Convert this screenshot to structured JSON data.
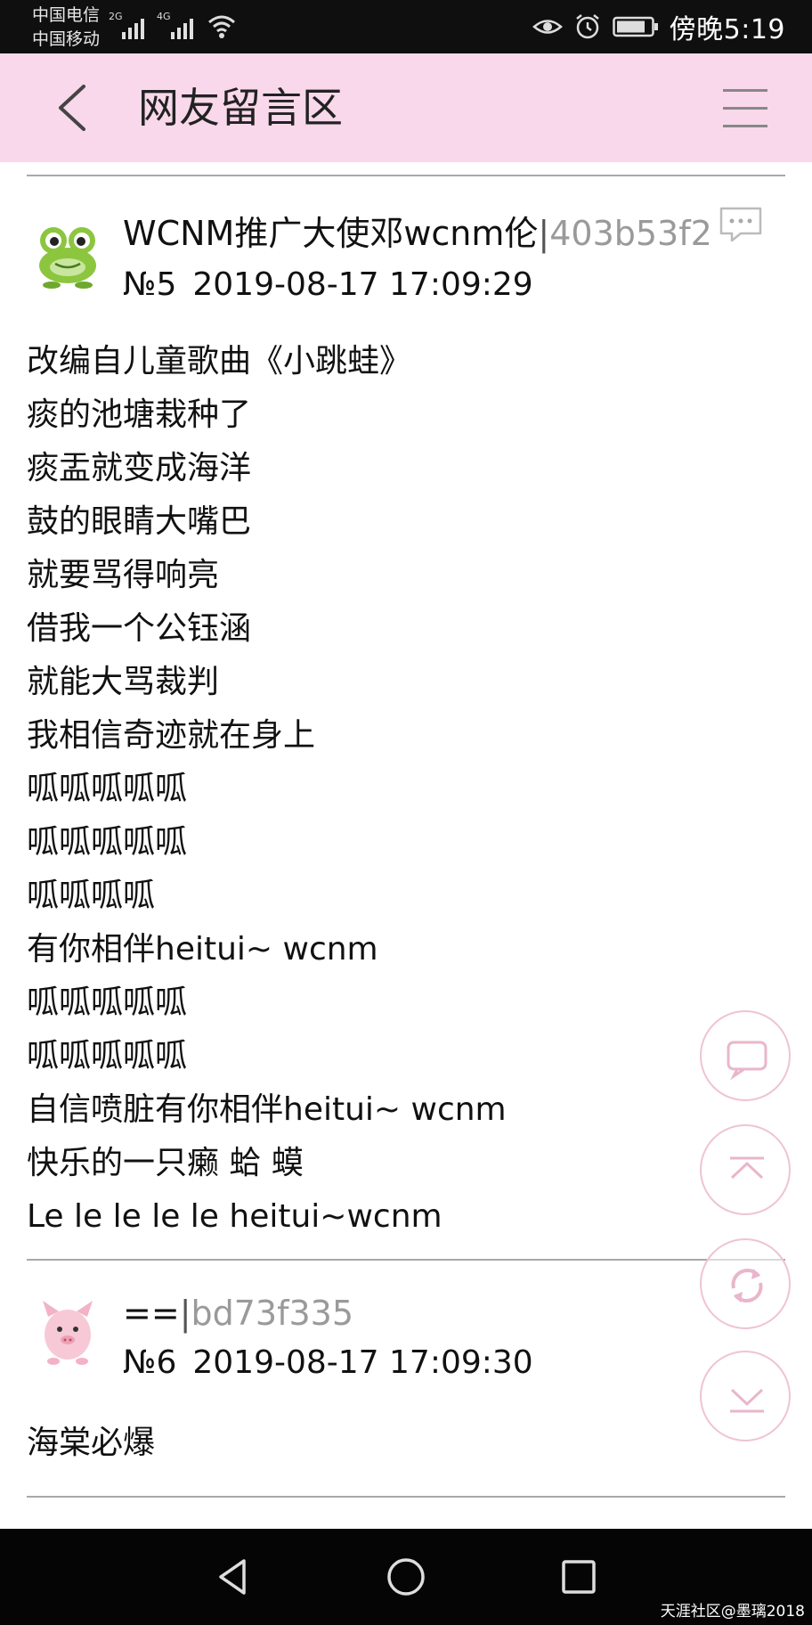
{
  "status_bar": {
    "carrier1": "中国电信",
    "carrier2": "中国移动",
    "network1": "2G",
    "network2": "4G",
    "time": "傍晚5:19",
    "icons": [
      "signal-icon",
      "wifi-icon",
      "eye-icon",
      "alarm-icon",
      "battery-icon"
    ]
  },
  "header": {
    "title": "网友留言区",
    "icons": [
      "back-icon",
      "menu-icon"
    ],
    "background": "#f9d8eb"
  },
  "posts": [
    {
      "author": "WCNM推广大使邓wcnm伦",
      "separator": "|",
      "user_id": "403b53f2",
      "number": "№5",
      "timestamp": "2019-08-17 17:09:29",
      "avatar": "frog-avatar",
      "lines": [
        "改编自儿童歌曲《小跳蛙》",
        "痰的池塘栽种了",
        "痰盂就变成海洋",
        "鼓的眼睛大嘴巴",
        "就要骂得响亮",
        "借我一个公钰涵",
        "就能大骂裁判",
        "我相信奇迹就在身上",
        "呱呱呱呱呱",
        "呱呱呱呱呱",
        "呱呱呱呱",
        "有你相伴heitui~ wcnm",
        "呱呱呱呱呱",
        "呱呱呱呱呱",
        "自信喷脏有你相伴heitui~ wcnm",
        "快乐的一只癞 蛤 蟆",
        "Le le le le le heitui~wcnm"
      ]
    },
    {
      "author": "==",
      "separator": "|",
      "user_id": "bd73f335",
      "number": "№6",
      "timestamp": "2019-08-17 17:09:30",
      "avatar": "pig-avatar",
      "lines": [
        "海棠必爆"
      ]
    }
  ],
  "floating_buttons": [
    "comment-button",
    "scroll-top-button",
    "refresh-button",
    "scroll-bottom-button"
  ],
  "nav_bar": {
    "icons": [
      "nav-back-icon",
      "nav-home-icon",
      "nav-recent-icon"
    ],
    "watermark": "天涯社区@墨璃2018"
  },
  "colors": {
    "accent_pink": "#f9d8eb",
    "fab_border": "#efc3d6",
    "user_id_gray": "#9a9a9a"
  }
}
